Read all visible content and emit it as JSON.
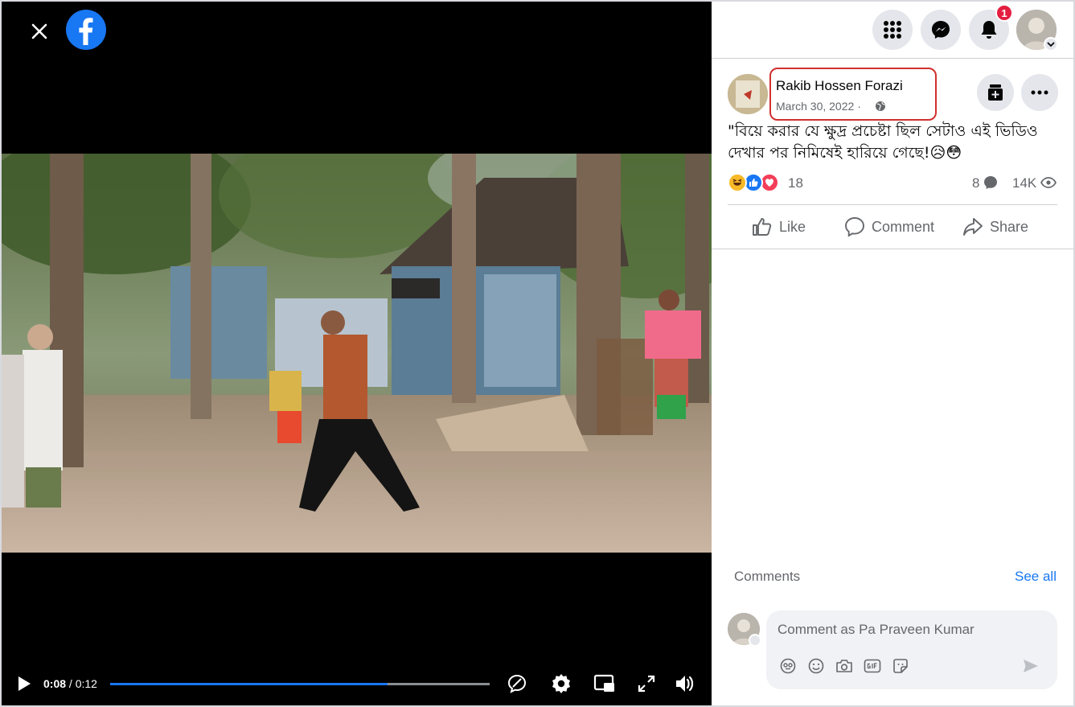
{
  "video": {
    "current_time": "0:08",
    "separator": "/",
    "duration": "0:12",
    "progress": 0.73
  },
  "header": {
    "notification_count": "1"
  },
  "post": {
    "author": "Rakib Hossen Forazi",
    "date": "March 30, 2022",
    "date_sep": "·",
    "caption": "\"বিয়ে করার যে ক্ষুদ্র প্রচেষ্টা ছিল সেটাও এই ভিডিও দেখার পর নিমিষেই হারিয়ে গেছে!😥😳",
    "reaction_count": "18",
    "comment_count": "8",
    "view_count": "14K"
  },
  "actions": {
    "like": "Like",
    "comment": "Comment",
    "share": "Share"
  },
  "comments": {
    "label": "Comments",
    "see_all": "See all",
    "placeholder": "Comment as Pa Praveen Kumar"
  },
  "colors": {
    "brand": "#1877f2",
    "badge": "#e41e3f",
    "highlight_box": "#d0312d"
  }
}
